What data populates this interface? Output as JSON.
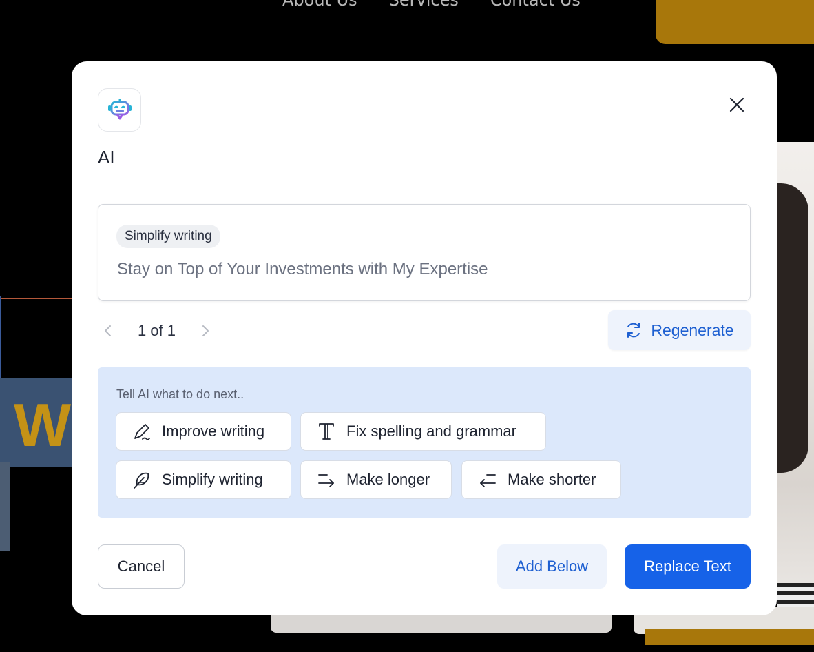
{
  "background": {
    "nav": [
      "About Us",
      "Services",
      "Contact Us"
    ],
    "hero_letter": "W"
  },
  "modal": {
    "title": "AI",
    "logo_icon": "robot-icon",
    "close_icon": "close-icon",
    "result": {
      "chip": "Simplify writing",
      "text": "Stay on Top of Your Investments with My Expertise"
    },
    "pager": {
      "text": "1 of 1"
    },
    "regenerate_label": "Regenerate",
    "actions": {
      "hint": "Tell AI what to do next..",
      "items": [
        {
          "label": "Improve writing",
          "icon": "pen-icon"
        },
        {
          "label": "Fix spelling and grammar",
          "icon": "text-icon"
        },
        {
          "label": "Simplify writing",
          "icon": "feather-icon"
        },
        {
          "label": "Make longer",
          "icon": "arrow-lengthen-icon"
        },
        {
          "label": "Make shorter",
          "icon": "arrow-shorten-icon"
        }
      ]
    },
    "footer": {
      "cancel_label": "Cancel",
      "add_below_label": "Add Below",
      "replace_label": "Replace Text"
    }
  },
  "colors": {
    "accent": "#1662e8",
    "accent_text": "#1d5fd1",
    "panel_bg": "#dce8fb",
    "brand_gold": "#a8770b"
  }
}
